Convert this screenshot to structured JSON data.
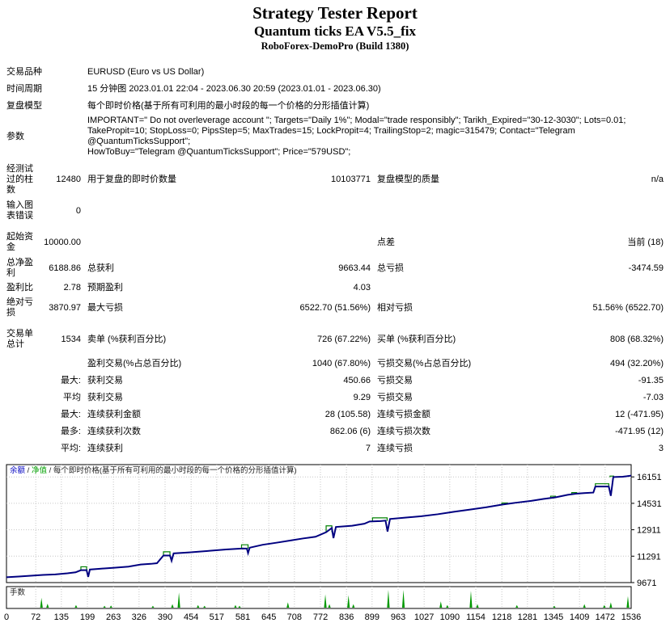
{
  "header": {
    "title": "Strategy Tester Report",
    "subtitle": "Quantum ticks EA V5.5_fix",
    "server": "RoboForex-DemoPro (Build 1380)"
  },
  "table": {
    "rows": [
      {
        "name": "symbol",
        "cls": "",
        "span": true,
        "c": [
          "交易品种",
          "",
          "EURUSD (Euro vs US Dollar)",
          "",
          "",
          ""
        ]
      },
      {
        "name": "period",
        "cls": "",
        "span": true,
        "c": [
          "时间周期",
          "",
          "15 分钟图 2023.01.01 22:04 - 2023.06.30 20:59 (2023.01.01 - 2023.06.30)",
          "",
          "",
          ""
        ]
      },
      {
        "name": "model",
        "cls": "",
        "span": true,
        "c": [
          "复盘模型",
          "",
          "每个即时价格(基于所有可利用的最小时段的每一个价格的分形插值计算)",
          "",
          "",
          ""
        ]
      },
      {
        "name": "parameters",
        "cls": "",
        "span": true,
        "c": [
          "参数",
          "",
          "IMPORTANT=\" Do not overleverage account \"; Targets=\"Daily 1%\"; Modal=\"trade responsibly\"; Tarikh_Expired=\"30-12-3030\"; Lots=0.01;\nTakePropit=10; StopLoss=0; PipsStep=5; MaxTrades=15; LockPropit=4; TrailingStop=2; magic=315479; Contact=\"Telegram @QuantumTicksSupport\";\nHowToBuy=\"Telegram @QuantumTicksSupport\"; Price=\"579USD\";",
          "",
          "",
          ""
        ]
      },
      {
        "name": "bars-tested",
        "cls": "mt6",
        "span": false,
        "c": [
          "经测试\n过的柱\n数",
          "12480",
          "用于复盘的即时价数量",
          "10103771",
          "复盘模型的质量",
          "n/a"
        ]
      },
      {
        "name": "chart-errors",
        "cls": "mt4",
        "span": false,
        "c": [
          "输入图\n表错误",
          "0",
          "",
          "",
          "",
          ""
        ]
      },
      {
        "name": "initial-deposit",
        "cls": "mt10",
        "span": false,
        "c": [
          "起始资\n金",
          "10000.00",
          "",
          "",
          "点差",
          "当前 (18)"
        ]
      },
      {
        "name": "net-profit",
        "cls": "mt4",
        "span": false,
        "c": [
          "总净盈\n利",
          "6188.86",
          "总获利",
          "9663.44",
          "总亏损",
          "-3474.59"
        ]
      },
      {
        "name": "profit-factor",
        "cls": "",
        "span": false,
        "c": [
          "盈利比",
          "2.78",
          "预期盈利",
          "4.03",
          "",
          ""
        ]
      },
      {
        "name": "absolute-drawdown",
        "cls": "",
        "span": false,
        "c": [
          "绝对亏\n损",
          "3870.97",
          "最大亏损",
          "6522.70 (51.56%)",
          "相对亏损",
          "51.56% (6522.70)"
        ]
      },
      {
        "name": "total-trades",
        "cls": "mt10",
        "span": false,
        "c": [
          "交易单\n总计",
          "1534",
          "卖单 (%获利百分比)",
          "726 (67.22%)",
          "买单 (%获利百分比)",
          "808 (68.32%)"
        ]
      },
      {
        "name": "profit-trades",
        "cls": "mt6",
        "span": false,
        "c": [
          "",
          "",
          "盈利交易(%占总百分比)",
          "1040 (67.80%)",
          "亏损交易(%占总百分比)",
          "494 (32.20%)"
        ]
      },
      {
        "name": "largest-trade",
        "cls": "",
        "span": false,
        "c": [
          "",
          "最大:",
          "获利交易",
          "450.66",
          "亏损交易",
          "-91.35"
        ]
      },
      {
        "name": "average-trade",
        "cls": "",
        "span": false,
        "c": [
          "",
          "平均",
          "获利交易",
          "9.29",
          "亏损交易",
          "-7.03"
        ]
      },
      {
        "name": "max-consecutive-amount",
        "cls": "",
        "span": false,
        "c": [
          "",
          "最大:",
          "连续获利金额",
          "28 (105.58)",
          "连续亏损金额",
          "12 (-471.95)"
        ]
      },
      {
        "name": "max-consecutive-count",
        "cls": "",
        "span": false,
        "c": [
          "",
          "最多:",
          "连续获利次数",
          "862.06 (6)",
          "连续亏损次数",
          "-471.95 (12)"
        ]
      },
      {
        "name": "avg-consecutive",
        "cls": "",
        "span": false,
        "c": [
          "",
          "平均:",
          "连续获利",
          "7",
          "连续亏损",
          "3"
        ]
      }
    ]
  },
  "chart_data": {
    "type": "line",
    "title": "余额 / 净值 / 每个即时价格(基于所有可利用的最小时段的每一个价格的分形插值计算)",
    "legend": {
      "balance_label": "余额",
      "equity_label": "净值",
      "separator": " / ",
      "model_label": "每个即时价格(基于所有可利用的最小时段的每一个价格的分形插值计算)",
      "lots_label": "手数"
    },
    "xlabel": "",
    "ylabel": "",
    "xlim": [
      0,
      1536
    ],
    "ylim": [
      9671,
      16904
    ],
    "x_ticks": [
      0,
      72,
      135,
      199,
      263,
      326,
      390,
      454,
      517,
      581,
      645,
      708,
      772,
      836,
      899,
      963,
      1027,
      1090,
      1154,
      1218,
      1281,
      1345,
      1409,
      1472,
      1536
    ],
    "y_ticks": [
      16151,
      14531,
      12911,
      11291,
      9671
    ],
    "grid": true,
    "legend_position": "top-left-inside",
    "colors": {
      "balance": "#000080",
      "equity": "#008000",
      "lots": "#009900",
      "legend_balance_text": "#0000c0",
      "legend_equity_text": "#00a000",
      "text": "#000000",
      "grid": "#c6c6c6"
    },
    "series": [
      {
        "name": "余额 (balance)",
        "points": [
          [
            0,
            10000
          ],
          [
            30,
            10040
          ],
          [
            60,
            10090
          ],
          [
            90,
            10140
          ],
          [
            120,
            10170
          ],
          [
            150,
            10240
          ],
          [
            170,
            10300
          ],
          [
            183,
            10430
          ],
          [
            197,
            10430
          ],
          [
            201,
            10020
          ],
          [
            205,
            10470
          ],
          [
            230,
            10520
          ],
          [
            265,
            10580
          ],
          [
            300,
            10650
          ],
          [
            330,
            10780
          ],
          [
            355,
            10820
          ],
          [
            370,
            10860
          ],
          [
            386,
            11330
          ],
          [
            402,
            11330
          ],
          [
            406,
            11010
          ],
          [
            411,
            11460
          ],
          [
            450,
            11520
          ],
          [
            500,
            11620
          ],
          [
            540,
            11700
          ],
          [
            565,
            11740
          ],
          [
            578,
            11760
          ],
          [
            591,
            11760
          ],
          [
            594,
            11480
          ],
          [
            598,
            11810
          ],
          [
            630,
            11990
          ],
          [
            665,
            12120
          ],
          [
            700,
            12260
          ],
          [
            730,
            12380
          ],
          [
            760,
            12480
          ],
          [
            786,
            12760
          ],
          [
            800,
            13020
          ],
          [
            804,
            12400
          ],
          [
            810,
            13080
          ],
          [
            850,
            13160
          ],
          [
            880,
            13280
          ],
          [
            893,
            13420
          ],
          [
            920,
            13440
          ],
          [
            932,
            13470
          ],
          [
            937,
            12800
          ],
          [
            943,
            13570
          ],
          [
            980,
            13650
          ],
          [
            1020,
            13740
          ],
          [
            1060,
            13860
          ],
          [
            1100,
            14010
          ],
          [
            1140,
            14150
          ],
          [
            1180,
            14290
          ],
          [
            1220,
            14460
          ],
          [
            1250,
            14560
          ],
          [
            1290,
            14680
          ],
          [
            1320,
            14800
          ],
          [
            1350,
            14900
          ],
          [
            1380,
            15050
          ],
          [
            1400,
            15120
          ],
          [
            1420,
            15160
          ],
          [
            1443,
            15190
          ],
          [
            1448,
            15560
          ],
          [
            1481,
            15560
          ],
          [
            1486,
            14990
          ],
          [
            1492,
            16140
          ],
          [
            1500,
            16150
          ],
          [
            1515,
            16160
          ],
          [
            1525,
            16190
          ],
          [
            1536,
            16230
          ]
        ]
      }
    ],
    "equity_segments": [
      {
        "t1": 183,
        "t2": 197,
        "v": 10640,
        "base": 10430
      },
      {
        "t1": 386,
        "t2": 402,
        "v": 11560,
        "base": 11330
      },
      {
        "t1": 578,
        "t2": 594,
        "v": 11990,
        "base": 11760
      },
      {
        "t1": 786,
        "t2": 800,
        "v": 13150,
        "base": 12760
      },
      {
        "t1": 900,
        "t2": 936,
        "v": 13640,
        "base": 13450
      },
      {
        "t1": 1218,
        "t2": 1232,
        "v": 14550,
        "base": 14460
      },
      {
        "t1": 1338,
        "t2": 1350,
        "v": 14970,
        "base": 14900
      },
      {
        "t1": 1390,
        "t2": 1402,
        "v": 15190,
        "base": 15120
      },
      {
        "t1": 1448,
        "t2": 1481,
        "v": 15730,
        "base": 15560
      },
      {
        "t1": 1484,
        "t2": 1493,
        "v": 16200,
        "base": 16130
      }
    ],
    "lots_spikes": [
      [
        86,
        0.55
      ],
      [
        101,
        0.22
      ],
      [
        171,
        0.15
      ],
      [
        241,
        0.1
      ],
      [
        257,
        0.12
      ],
      [
        360,
        0.1
      ],
      [
        408,
        0.2
      ],
      [
        424,
        0.85
      ],
      [
        471,
        0.15
      ],
      [
        487,
        0.1
      ],
      [
        563,
        0.15
      ],
      [
        573,
        0.1
      ],
      [
        692,
        0.3
      ],
      [
        784,
        0.75
      ],
      [
        794,
        0.2
      ],
      [
        841,
        0.7
      ],
      [
        853,
        0.2
      ],
      [
        939,
        1.0
      ],
      [
        976,
        1.0
      ],
      [
        1068,
        0.35
      ],
      [
        1084,
        0.15
      ],
      [
        1142,
        0.95
      ],
      [
        1158,
        0.2
      ],
      [
        1255,
        0.15
      ],
      [
        1347,
        0.1
      ],
      [
        1421,
        0.2
      ],
      [
        1470,
        0.15
      ],
      [
        1486,
        0.3
      ],
      [
        1528,
        0.65
      ]
    ]
  }
}
